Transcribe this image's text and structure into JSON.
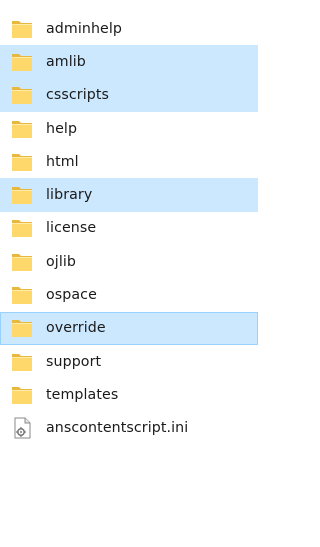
{
  "explorer": {
    "items": [
      {
        "name": "adminhelp",
        "type": "folder",
        "state": "normal"
      },
      {
        "name": "amlib",
        "type": "folder",
        "state": "selected"
      },
      {
        "name": "csscripts",
        "type": "folder",
        "state": "selected"
      },
      {
        "name": "help",
        "type": "folder",
        "state": "normal"
      },
      {
        "name": "html",
        "type": "folder",
        "state": "normal"
      },
      {
        "name": "library",
        "type": "folder",
        "state": "selected"
      },
      {
        "name": "license",
        "type": "folder",
        "state": "normal"
      },
      {
        "name": "ojlib",
        "type": "folder",
        "state": "normal"
      },
      {
        "name": "ospace",
        "type": "folder",
        "state": "normal"
      },
      {
        "name": "override",
        "type": "folder",
        "state": "selected-focus"
      },
      {
        "name": "support",
        "type": "folder",
        "state": "normal"
      },
      {
        "name": "templates",
        "type": "folder",
        "state": "normal"
      },
      {
        "name": "anscontentscript.ini",
        "type": "ini-file",
        "state": "normal"
      }
    ],
    "colors": {
      "selection": "#cce8ff",
      "focus_border": "#99d1ff",
      "folder_body": "#ffd86b",
      "folder_tab": "#e8b73e"
    }
  }
}
